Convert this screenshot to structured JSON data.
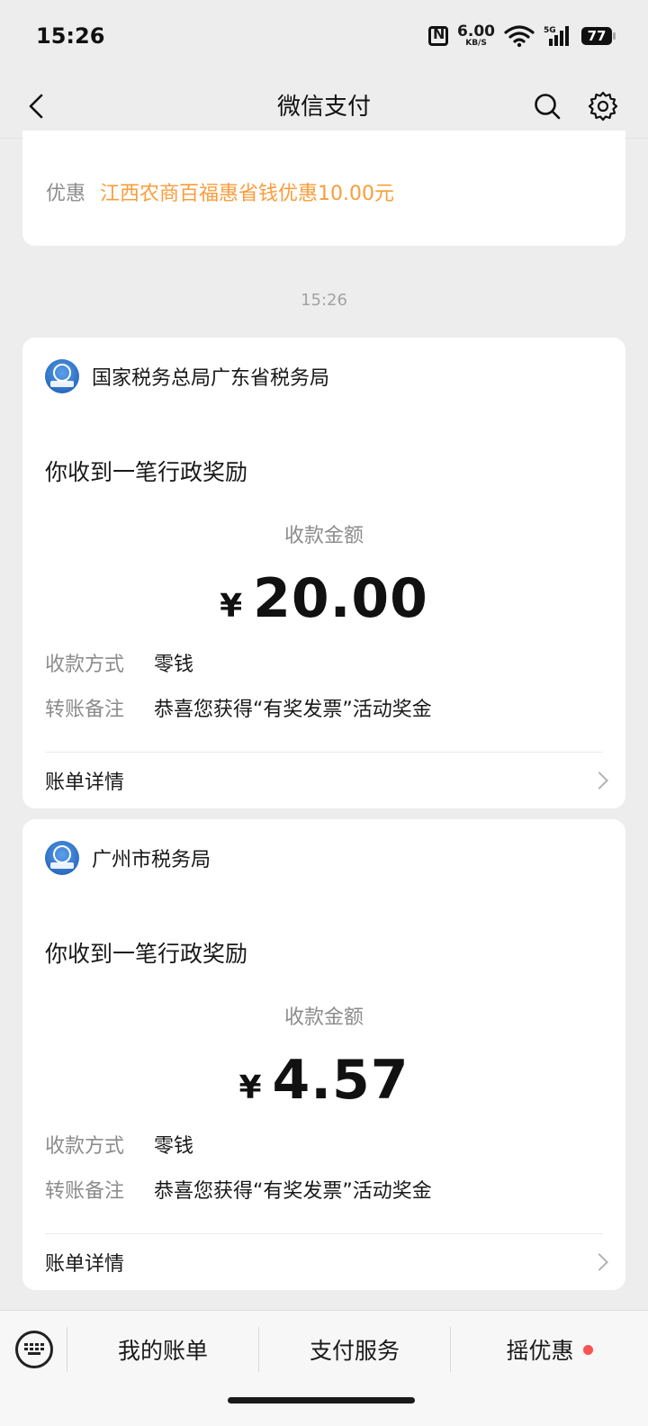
{
  "status_bar": {
    "time": "15:26",
    "net_speed_value": "6.00",
    "net_speed_unit": "KB/S",
    "battery": "77",
    "icons": [
      "nfc-icon",
      "wifi-icon",
      "signal-5g-icon",
      "battery-icon"
    ]
  },
  "nav": {
    "title": "微信支付",
    "icons": [
      "back-icon",
      "search-icon",
      "settings-icon"
    ]
  },
  "top_card": {
    "discount_label": "优惠",
    "discount_value": "江西农商百福惠省钱优惠10.00元"
  },
  "timestamp": "15:26",
  "messages": [
    {
      "sender": "国家税务总局广东省税务局",
      "title": "你收到一笔行政奖励",
      "amount_label": "收款金额",
      "currency": "¥",
      "amount": "20.00",
      "method_label": "收款方式",
      "method_value": "零钱",
      "note_label": "转账备注",
      "note_value": "恭喜您获得“有奖发票”活动奖金",
      "bill_link": "账单详情"
    },
    {
      "sender": "广州市税务局",
      "title": "你收到一笔行政奖励",
      "amount_label": "收款金额",
      "currency": "¥",
      "amount": "4.57",
      "method_label": "收款方式",
      "method_value": "零钱",
      "note_label": "转账备注",
      "note_value": "恭喜您获得“有奖发票”活动奖金",
      "bill_link": "账单详情"
    }
  ],
  "bottom_menu": {
    "items": [
      "我的账单",
      "支付服务",
      "摇优惠"
    ],
    "badge_color": "#fa5151"
  },
  "colors": {
    "accent_orange": "#fa9d3b",
    "background": "#ededed",
    "muted_text": "#8c8c8c"
  }
}
